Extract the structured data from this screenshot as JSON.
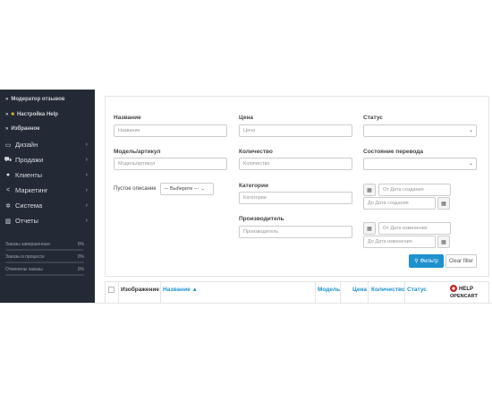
{
  "sidebar": {
    "subitems": [
      {
        "label": "Модератор отзывов"
      },
      {
        "label": "Настройка Help"
      },
      {
        "label": "Избранное"
      }
    ],
    "items": [
      {
        "label": "Дизайн",
        "icon": "monitor-icon"
      },
      {
        "label": "Продажи",
        "icon": "cart-icon"
      },
      {
        "label": "Клиенты",
        "icon": "user-icon"
      },
      {
        "label": "Маркетинг",
        "icon": "share-icon"
      },
      {
        "label": "Система",
        "icon": "gear-icon"
      },
      {
        "label": "Отчеты",
        "icon": "bar-chart-icon"
      }
    ],
    "stats": [
      {
        "label": "Заказы завершенные",
        "value": "0%",
        "percent": 0
      },
      {
        "label": "Заказы в процессе",
        "value": "0%",
        "percent": 0
      },
      {
        "label": "Отменены заказы",
        "value": "0%",
        "percent": 0
      }
    ]
  },
  "filter": {
    "name_label": "Название",
    "name_placeholder": "Название",
    "price_label": "Цена",
    "price_placeholder": "Цена",
    "status_label": "Статус",
    "model_label": "Модель/артикул",
    "model_placeholder": "Модель/артикул",
    "quantity_label": "Количество",
    "quantity_placeholder": "Количество",
    "translation_label": "Состояние перевода",
    "empty_desc_label": "Пустое описание",
    "empty_desc_value": "--- Выберите ---",
    "categories_label": "Категории",
    "categories_placeholder": "Категории",
    "date_created_from": "От Дата создания",
    "date_created_to": "До Дата создания",
    "manufacturer_label": "Производитель",
    "manufacturer_placeholder": "Производитель",
    "date_modified_from": "От Дата изменения",
    "date_modified_to": "До Дата изменения",
    "filter_button": "Фильтр",
    "clear_button": "Clear filter"
  },
  "table": {
    "headers": [
      "Изображение",
      "Название ▲",
      "Модель",
      "Цена",
      "Количество",
      "Статус"
    ]
  },
  "logo": {
    "line1": "HELP",
    "line2": "OPENCART"
  },
  "colors": {
    "accent": "#1e91cf",
    "sidebar_bg": "#232a35"
  }
}
